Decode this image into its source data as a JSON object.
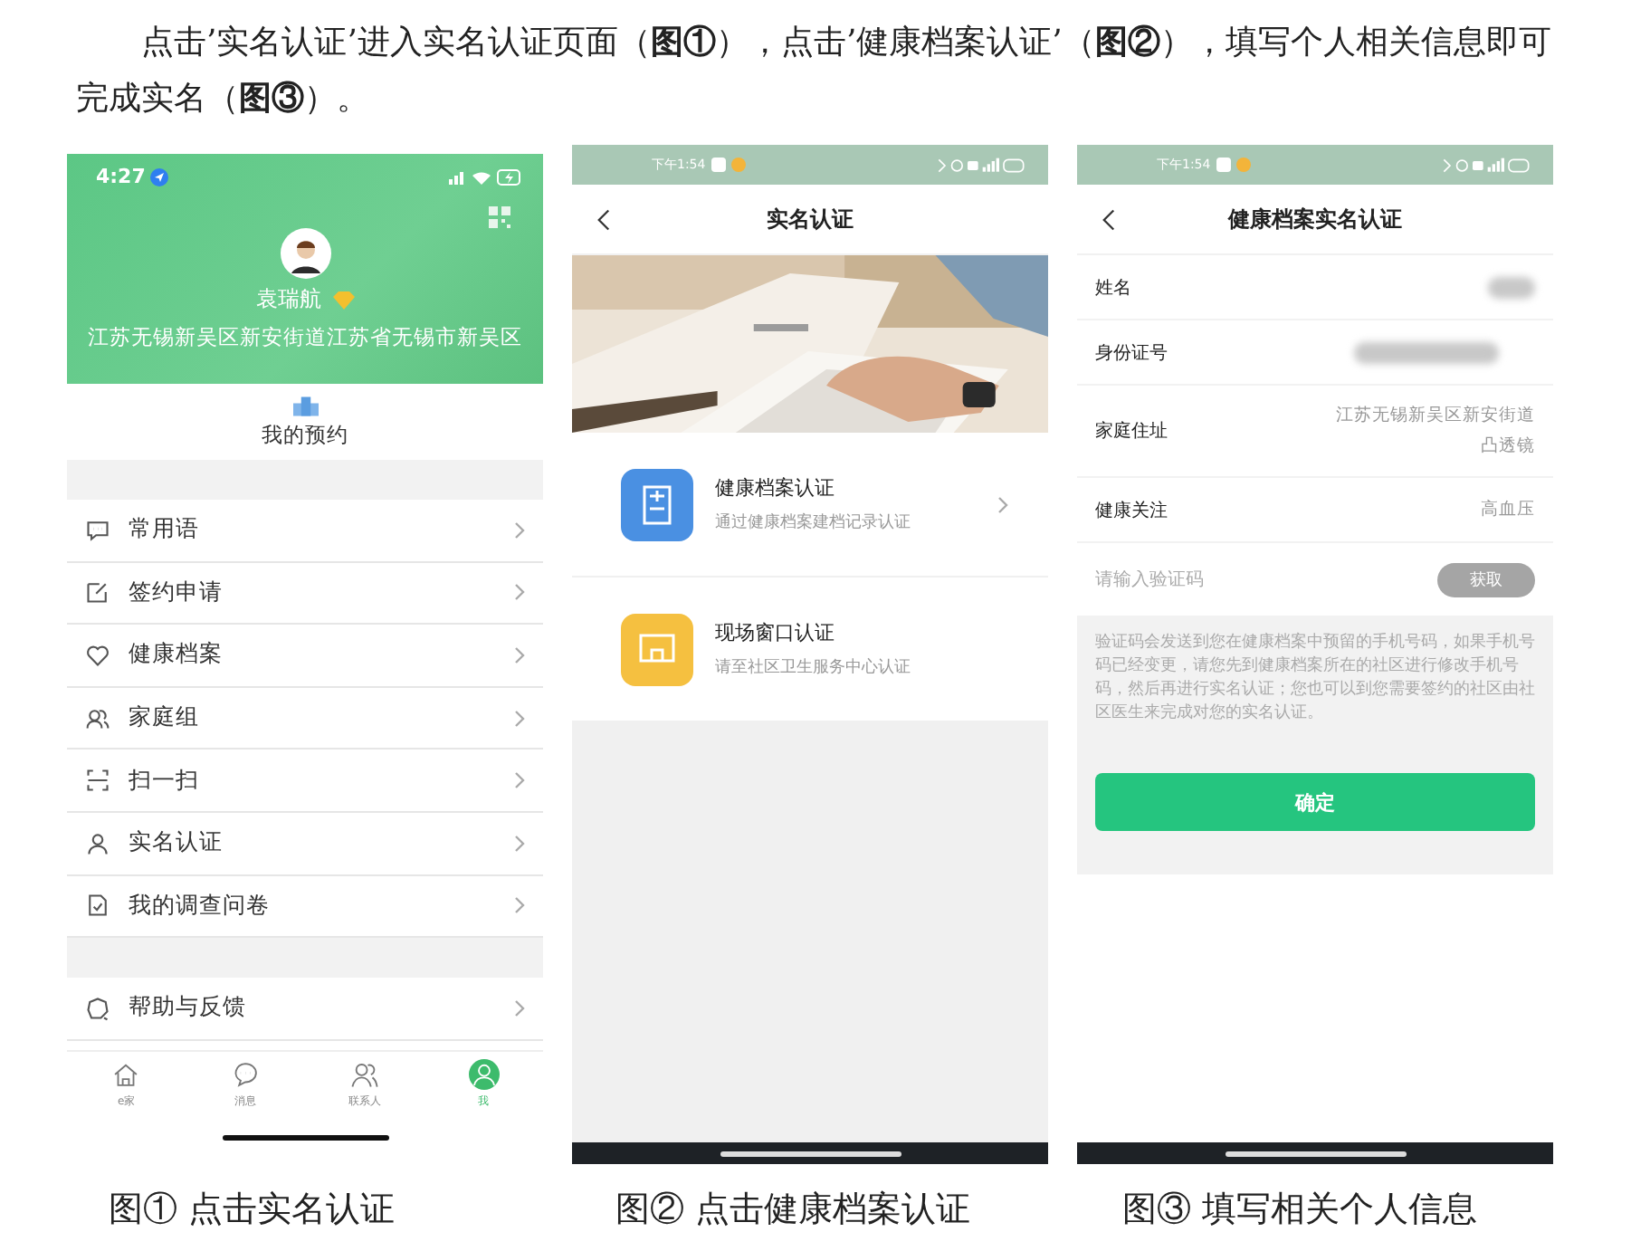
{
  "intro": "点击’实名认证’进入实名认证页面（**图①**），点击’健康档案认证’（**图②**），填写个人相关信息即可完成实名（**图③**）。",
  "profile_screen": {
    "time": "4:27",
    "user_name": "袁瑞航",
    "address": "江苏无锡新吴区新安街道江苏省无锡市新吴区",
    "shortcut": "我的预约",
    "menu_groups": [
      [
        "常用语",
        "签约申请",
        "健康档案",
        "家庭组",
        "扫一扫",
        "实名认证",
        "我的调查问卷"
      ],
      [
        "帮助与反馈"
      ]
    ],
    "tabs": [
      {
        "label": "e家",
        "selected": false
      },
      {
        "label": "消息",
        "selected": false
      },
      {
        "label": "联系人",
        "selected": false
      },
      {
        "label": "我",
        "selected": true
      }
    ]
  },
  "auth_screen": {
    "time": "下午1:54",
    "title": "实名认证",
    "options": [
      {
        "title": "健康档案认证",
        "subtitle": "通过健康档案建档记录认证",
        "color": "#4a90e2",
        "chevron": true
      },
      {
        "title": "现场窗口认证",
        "subtitle": "请至社区卫生服务中心认证",
        "color": "#f5c040",
        "chevron": false
      }
    ]
  },
  "form_screen": {
    "time": "下午1:54",
    "title": "健康档案实名认证",
    "rows": [
      {
        "kind": "redacted",
        "label": "姓名"
      },
      {
        "kind": "redacted",
        "label": "身份证号"
      },
      {
        "kind": "text",
        "label": "家庭住址",
        "value": [
          "江苏无锡新吴区新安街道",
          "凸透镜"
        ]
      },
      {
        "kind": "text",
        "label": "健康关注",
        "value": [
          "高血压"
        ]
      }
    ],
    "code_field": {
      "placeholder": "请输入验证码",
      "button": "获取",
      "disabled": true
    },
    "note": "验证码会发送到您在健康档案中预留的手机号码，如果手机号码已经变更，请您先到健康档案所在的社区进行修改手机号码，然后再进行实名认证；您也可以到您需要签约的社区由社区医生来完成对您的实名认证。",
    "confirm": "确定"
  },
  "captions": [
    "图①  点击实名认证",
    "图②  点击健康档案认证",
    "图③  填写相关个人信息"
  ]
}
